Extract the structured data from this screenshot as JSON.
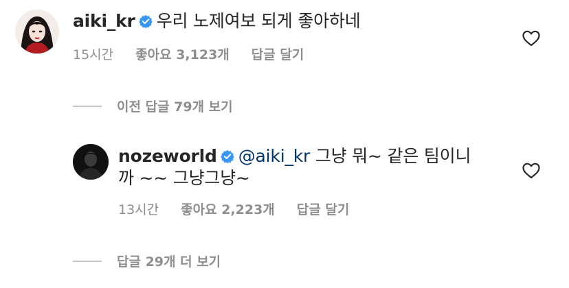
{
  "comments": [
    {
      "username": "aiki_kr",
      "text": "우리 노제여보 되게 좋아하네",
      "time": "15시간",
      "likes": "좋아요 3,123개",
      "reply": "답글 달기"
    }
  ],
  "view_previous_replies": "이전 답글 79개 보기",
  "reply_comment": {
    "username": "nozeworld",
    "mention": "@aiki_kr",
    "text_line1": "그냥 뭐~ 같은 팀이니",
    "text_line2": "까 ~~ 그냥그냥~",
    "time": "13시간",
    "likes": "좋아요 2,223개",
    "reply": "답글 달기"
  },
  "view_more_replies": "답글 29개 더 보기",
  "icons": {
    "verified": "verified-badge-icon",
    "like": "heart-outline-icon"
  },
  "colors": {
    "verified_blue": "#3897f0",
    "mention": "#00376b",
    "meta_gray": "#8e8e8e"
  }
}
